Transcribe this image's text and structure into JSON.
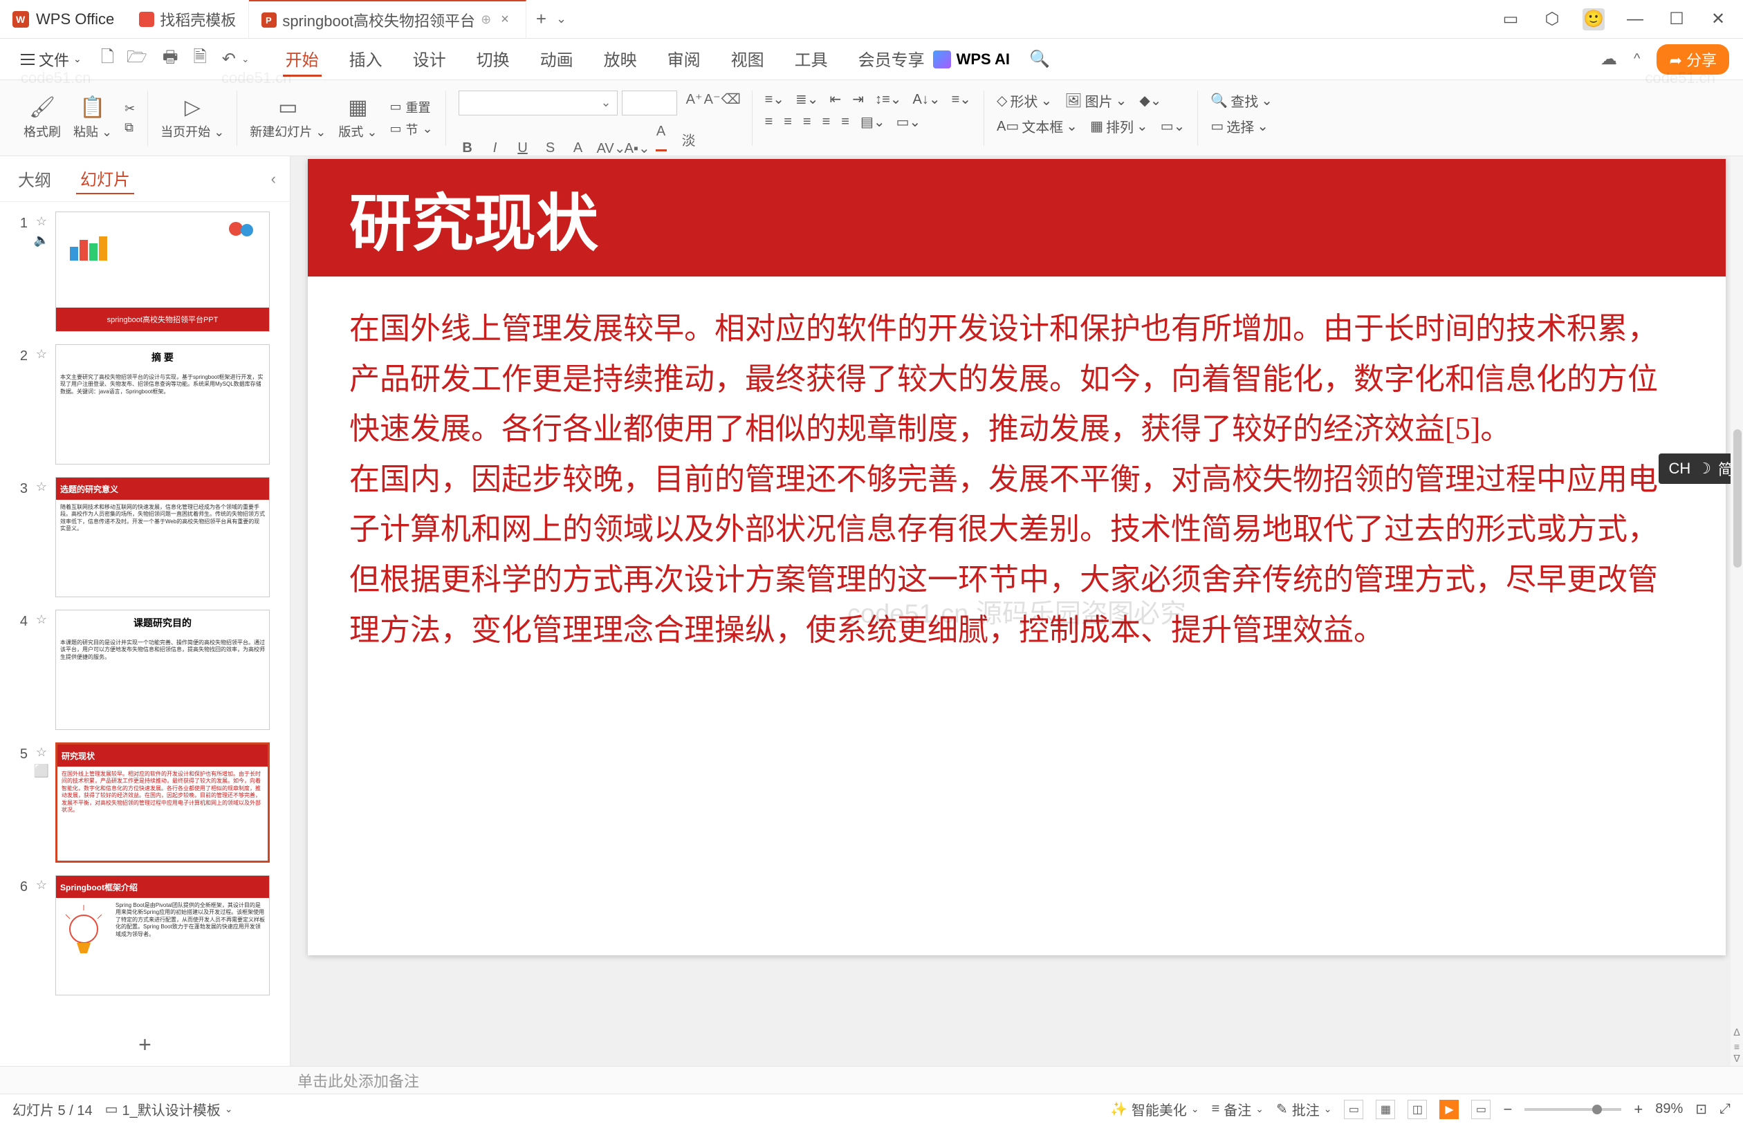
{
  "titlebar": {
    "app_name": "WPS Office",
    "tabs": [
      {
        "label": "找稻壳模板"
      },
      {
        "label": "springboot高校失物招领平台"
      }
    ],
    "close": "×",
    "add": "+",
    "dropdown": "⌄"
  },
  "window_controls": {
    "restore": "▢",
    "cube": "⬚",
    "avatar": "👤",
    "minimize": "—",
    "maximize": "☐",
    "close": "✕"
  },
  "menubar": {
    "file": "文件",
    "tabs": [
      "开始",
      "插入",
      "设计",
      "切换",
      "动画",
      "放映",
      "审阅",
      "视图",
      "工具",
      "会员专享"
    ],
    "active_tab": "开始",
    "wpsai": "WPS AI",
    "share": "分享"
  },
  "ribbon": {
    "format_brush": "格式刷",
    "paste": "粘贴",
    "page_start": "当页开始",
    "new_slide": "新建幻灯片",
    "layout": "版式",
    "reset": "重置",
    "section": "节",
    "shape": "形状",
    "image": "图片",
    "textbox": "文本框",
    "arrange": "排列",
    "find": "查找",
    "select": "选择",
    "cut_icon": "✂",
    "copy_icon": "⧉"
  },
  "sidepanel": {
    "tabs": {
      "outline": "大纲",
      "slides": "幻灯片"
    },
    "collapse": "‹",
    "slides": [
      {
        "num": "1",
        "title": "springboot高校失物招领平台PPT",
        "type": "title"
      },
      {
        "num": "2",
        "title": "摘 要",
        "type": "text"
      },
      {
        "num": "3",
        "title": "选题的研究意义",
        "type": "redbar"
      },
      {
        "num": "4",
        "title": "课题研究目的",
        "type": "text"
      },
      {
        "num": "5",
        "title": "研究现状",
        "type": "redbar_selected"
      },
      {
        "num": "6",
        "title": "Springboot框架介绍",
        "type": "redbar_img"
      }
    ],
    "icons": {
      "star": "☆",
      "speaker": "🔈",
      "stop": "⬜"
    },
    "add": "+"
  },
  "slide": {
    "title": "研究现状",
    "body": "在国外线上管理发展较早。相对应的软件的开发设计和保护也有所增加。由于长时间的技术积累，产品研发工作更是持续推动，最终获得了较大的发展。如今，向着智能化，数字化和信息化的方位快速发展。各行各业都使用了相似的规章制度，推动发展，获得了较好的经济效益[5]。\n在国内，因起步较晚，目前的管理还不够完善，发展不平衡，对高校失物招领的管理过程中应用电子计算机和网上的领域以及外部状况信息存有很大差别。技术性简易地取代了过去的形式或方式，但根据更科学的方式再次设计方案管理的这一环节中，大家必须舍弃传统的管理方式，尽早更改管理方法，变化管理理念合理操纵，使系统更细腻，控制成本、提升管理效益。",
    "watermark_center": "code51.cn 源码乐园盗图必究"
  },
  "ime": {
    "label": "CH",
    "mode": "简"
  },
  "notes": {
    "placeholder": "单击此处添加备注"
  },
  "statusbar": {
    "slide_counter": "幻灯片 5 / 14",
    "template": "1_默认设计模板",
    "beautify": "智能美化",
    "notes": "备注",
    "review": "批注",
    "zoom_pct": "89%",
    "zoom_minus": "−",
    "zoom_plus": "+"
  },
  "watermarks": [
    "code51.cn"
  ]
}
